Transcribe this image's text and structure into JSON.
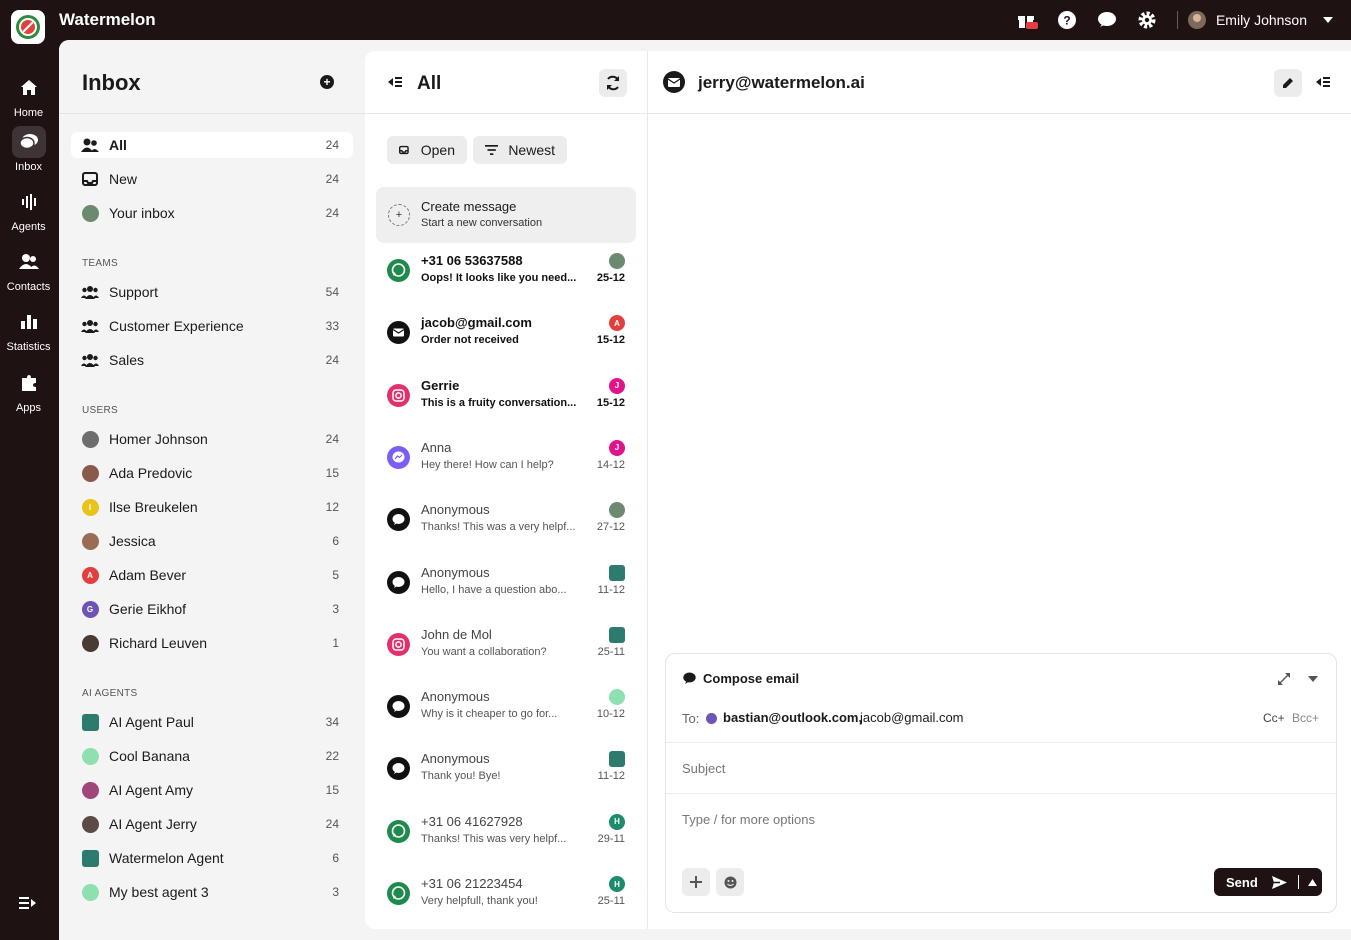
{
  "app": {
    "title": "Watermelon"
  },
  "topbar": {
    "user_name": "Emily Johnson",
    "gift_badge": "NEW"
  },
  "rail": [
    {
      "label": "Home",
      "icon": "home-icon"
    },
    {
      "label": "Inbox",
      "icon": "inbox-icon"
    },
    {
      "label": "Agents",
      "icon": "agents-icon"
    },
    {
      "label": "Contacts",
      "icon": "contacts-icon"
    },
    {
      "label": "Statistics",
      "icon": "statistics-icon"
    },
    {
      "label": "Apps",
      "icon": "apps-icon"
    }
  ],
  "inbox": {
    "title": "Inbox",
    "main_items": [
      {
        "label": "All",
        "count": "24"
      },
      {
        "label": "New",
        "count": "24"
      },
      {
        "label": "Your inbox",
        "count": "24"
      }
    ],
    "teams_label": "TEAMS",
    "teams": [
      {
        "label": "Support",
        "count": "54"
      },
      {
        "label": "Customer Experience",
        "count": "33"
      },
      {
        "label": "Sales",
        "count": "24"
      }
    ],
    "users_label": "USERS",
    "users": [
      {
        "label": "Homer Johnson",
        "count": "24"
      },
      {
        "label": "Ada Predovic",
        "count": "15"
      },
      {
        "label": "Ilse Breukelen",
        "count": "12",
        "initial": "I"
      },
      {
        "label": "Jessica",
        "count": "6"
      },
      {
        "label": "Adam Bever",
        "count": "5",
        "initial": "A"
      },
      {
        "label": "Gerie Eikhof",
        "count": "3",
        "initial": "G"
      },
      {
        "label": "Richard Leuven",
        "count": "1"
      }
    ],
    "agents_label": "AI AGENTS",
    "agents": [
      {
        "label": "AI Agent Paul",
        "count": "34"
      },
      {
        "label": "Cool Banana",
        "count": "22"
      },
      {
        "label": "AI Agent Amy",
        "count": "15"
      },
      {
        "label": "AI Agent Jerry",
        "count": "24"
      },
      {
        "label": "Watermelon Agent",
        "count": "6"
      },
      {
        "label": "My best agent 3",
        "count": "3"
      }
    ]
  },
  "conversations": {
    "title": "All",
    "filter_status": "Open",
    "filter_sort": "Newest",
    "create_title": "Create message",
    "create_sub": "Start a new conversation",
    "items": [
      {
        "name": "+31 06 53637588",
        "preview": "Oops! It looks like you need...",
        "date": "25-12",
        "channel": "whatsapp",
        "unread": true,
        "avatar": ""
      },
      {
        "name": "jacob@gmail.com",
        "preview": "Order not received",
        "date": "15-12",
        "channel": "email",
        "unread": true,
        "avatar": "A"
      },
      {
        "name": "Gerrie",
        "preview": "This is a fruity conversation...",
        "date": "15-12",
        "channel": "instagram",
        "unread": true,
        "avatar": "J"
      },
      {
        "name": "Anna",
        "preview": "Hey there! How can I help?",
        "date": "14-12",
        "channel": "messenger",
        "unread": false,
        "avatar": "J"
      },
      {
        "name": "Anonymous",
        "preview": "Thanks! This was a very helpf...",
        "date": "27-12",
        "channel": "chat",
        "unread": false,
        "avatar": ""
      },
      {
        "name": "Anonymous",
        "preview": "Hello, I have a question abo...",
        "date": "11-12",
        "channel": "chat",
        "unread": false,
        "avatar": ""
      },
      {
        "name": "John de Mol",
        "preview": "You want a collaboration?",
        "date": "25-11",
        "channel": "instagram",
        "unread": false,
        "avatar": ""
      },
      {
        "name": "Anonymous",
        "preview": "Why is it cheaper to go for...",
        "date": "10-12",
        "channel": "chat",
        "unread": false,
        "avatar": ""
      },
      {
        "name": "Anonymous",
        "preview": "Thank you! Bye!",
        "date": "11-12",
        "channel": "chat",
        "unread": false,
        "avatar": ""
      },
      {
        "name": "+31 06 41627928",
        "preview": "Thanks! This was very helpf...",
        "date": "29-11",
        "channel": "whatsapp",
        "unread": false,
        "avatar": "H"
      },
      {
        "name": "+31 06 21223454",
        "preview": "Very helpfull, thank you!",
        "date": "25-11",
        "channel": "whatsapp",
        "unread": false,
        "avatar": "H"
      }
    ]
  },
  "detail": {
    "title": "jerry@watermelon.ai",
    "compose": {
      "title": "Compose email",
      "to_label": "To:",
      "recipient_1": "bastian@outlook.com,",
      "recipient_2": "jacob@gmail.com",
      "cc": "Cc+",
      "bcc": "Bcc+",
      "subject_placeholder": "Subject",
      "body_placeholder": "Type / for more options",
      "send_label": "Send"
    }
  },
  "colors": {
    "dark": "#1f1213",
    "whatsapp": "#1e8a4c",
    "instagram": "#e1306c",
    "messenger": "#7b5cf5"
  }
}
